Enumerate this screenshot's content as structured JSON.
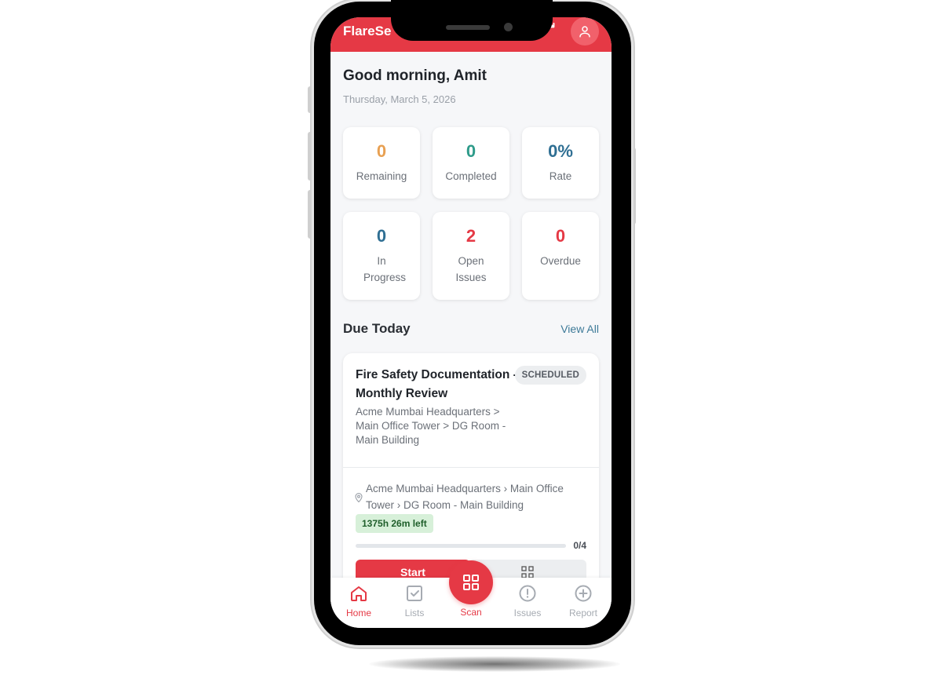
{
  "app": {
    "title": "FlareSe"
  },
  "header": {
    "greeting": "Good morning, Amit",
    "date": "Thursday, March 5, 2026"
  },
  "stats": [
    {
      "value": "0",
      "label": "Remaining",
      "color": "#e8a052"
    },
    {
      "value": "0",
      "label": "Completed",
      "color": "#2e9b8a"
    },
    {
      "value": "0%",
      "label": "Rate",
      "color": "#2f6f93"
    },
    {
      "value": "0",
      "label": "In Progress",
      "color": "#2f6f93"
    },
    {
      "value": "2",
      "label": "Open Issues",
      "color": "#e53945"
    },
    {
      "value": "0",
      "label": "Overdue",
      "color": "#e53945"
    }
  ],
  "due_today": {
    "title": "Due Today",
    "view_all": "View All",
    "card": {
      "title": "Fire Safety Documentation - Monthly Review",
      "badge": "SCHEDULED",
      "path": "Acme Mumbai Headquarters > Main Office Tower > DG Room - Main Building",
      "location": "Acme Mumbai Headquarters › Main Office Tower › DG Room - Main Building",
      "time_left": "1375h 26m left",
      "progress": {
        "done": 0,
        "total": 4,
        "label": "0/4"
      },
      "start_label": "Start"
    }
  },
  "nav": {
    "home": "Home",
    "lists": "Lists",
    "scan": "Scan",
    "issues": "Issues",
    "report": "Report",
    "active": "home"
  },
  "colors": {
    "brand": "#e53945",
    "inactive": "#a6abb2"
  }
}
